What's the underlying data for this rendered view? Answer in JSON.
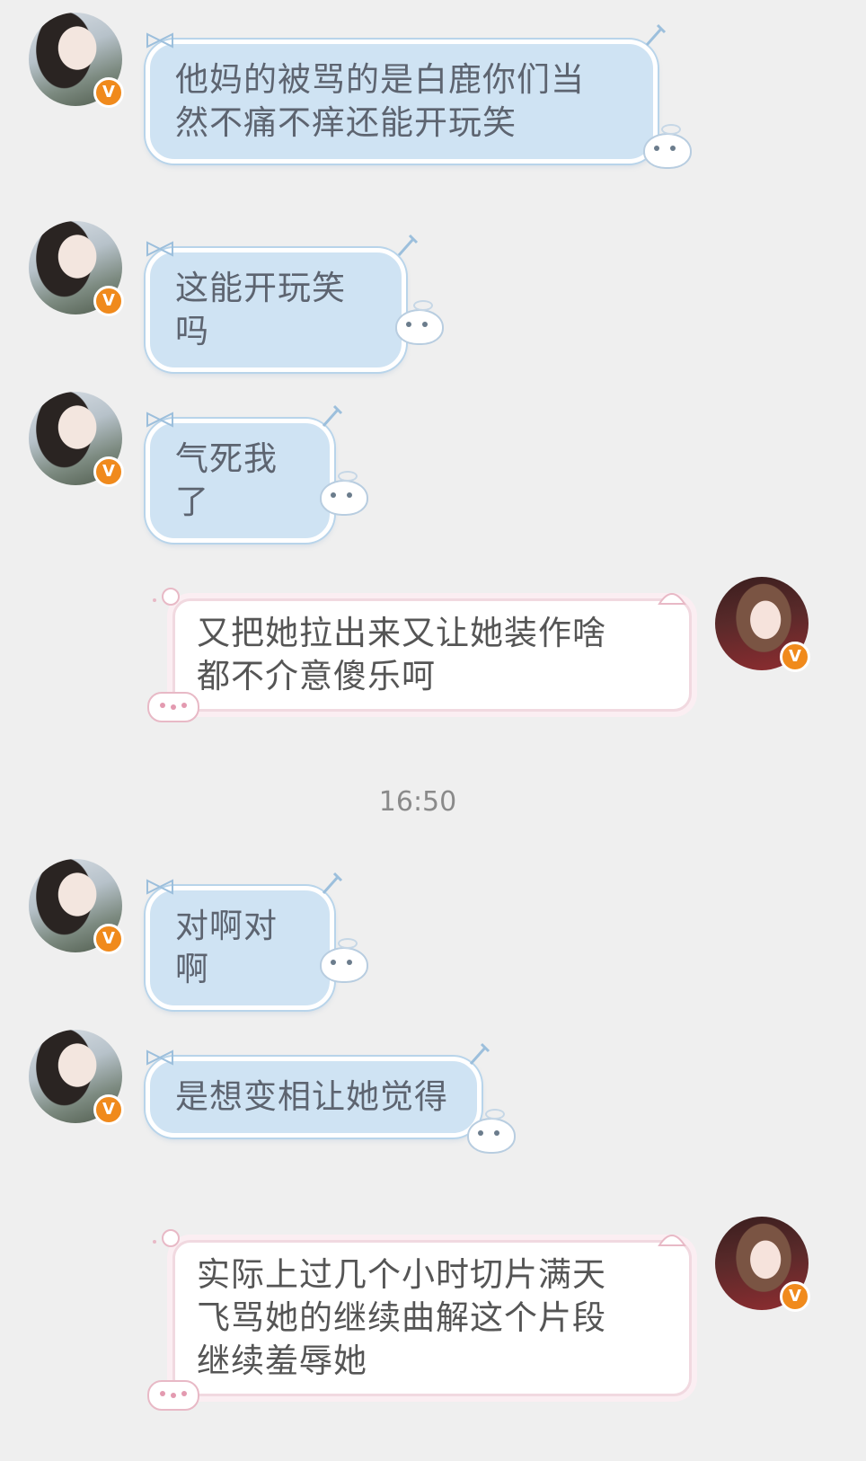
{
  "messages": [
    {
      "side": "left",
      "text": "他妈的被骂的是白鹿你们当然不痛不痒还能开玩笑",
      "line1": "他妈的被骂的是白鹿你们当",
      "line2": "然不痛不痒还能开玩笑"
    },
    {
      "side": "left",
      "text": "这能开玩笑吗"
    },
    {
      "side": "left",
      "text": "气死我了"
    },
    {
      "side": "right",
      "line1": "又把她拉出来又让她装作啥",
      "line2": "都不介意傻乐呵"
    },
    {
      "side": "left",
      "text": "对啊对啊"
    },
    {
      "side": "left",
      "text": "是想变相让她觉得"
    },
    {
      "side": "right",
      "line1": "实际上过几个小时切片满天",
      "line2": "飞骂她的继续曲解这个片段",
      "line3": "继续羞辱她"
    }
  ],
  "timestamp": "16:50",
  "badge": "V",
  "colors": {
    "blue_bubble": "#cfe3f3",
    "pink_border": "#f1d9e0",
    "badge": "#f08a1c",
    "background": "#efefef"
  }
}
